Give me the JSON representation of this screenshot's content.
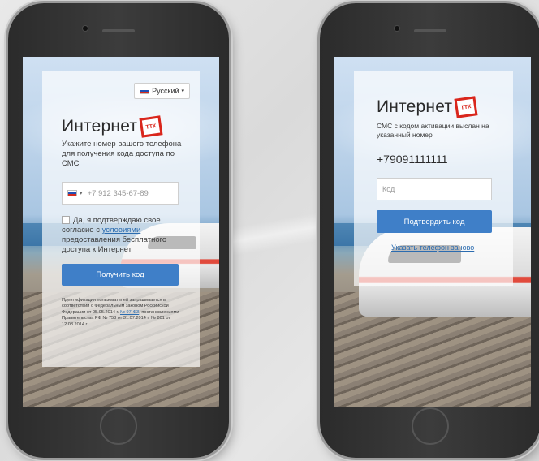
{
  "colors": {
    "accent": "#3f7fc8",
    "brand_red": "#d9261c",
    "link": "#2b6cb0"
  },
  "left": {
    "language": {
      "label": "Русский",
      "flag": "ru-flag-icon",
      "caret": "▾"
    },
    "brand": {
      "text": "Интернет",
      "logo_text": "ТТК"
    },
    "instruction": "Укажите номер вашего телефона для получения кода доступа по СМС",
    "phone": {
      "caret": "▾",
      "placeholder": "+7 912 345-67-89"
    },
    "consent": {
      "text_before": "Да, я подтверждаю свое согласие с ",
      "link": "условиями",
      "text_after": " предоставления бесплатного доступа к Интернет"
    },
    "submit_label": "Получить код",
    "legal": {
      "text_before": "Идентификация пользователей запрашивается в соответствии с Федеральным законом Российской Федерации от 05.05.2014 г. ",
      "link": "№ 97-ФЗ",
      "text_after": ", постановлениями Правительства РФ № 758 от 31.07.2014 г. № 801 от 12.08.2014 г."
    }
  },
  "right": {
    "brand": {
      "text": "Интернет",
      "logo_text": "ТТК"
    },
    "sms_notice": "СМС с кодом активации выслан на указанный номер",
    "phone_number": "+79091111111",
    "code_placeholder": "Код",
    "confirm_label": "Подтвердить код",
    "resend_link": "Указать телефон заново"
  }
}
